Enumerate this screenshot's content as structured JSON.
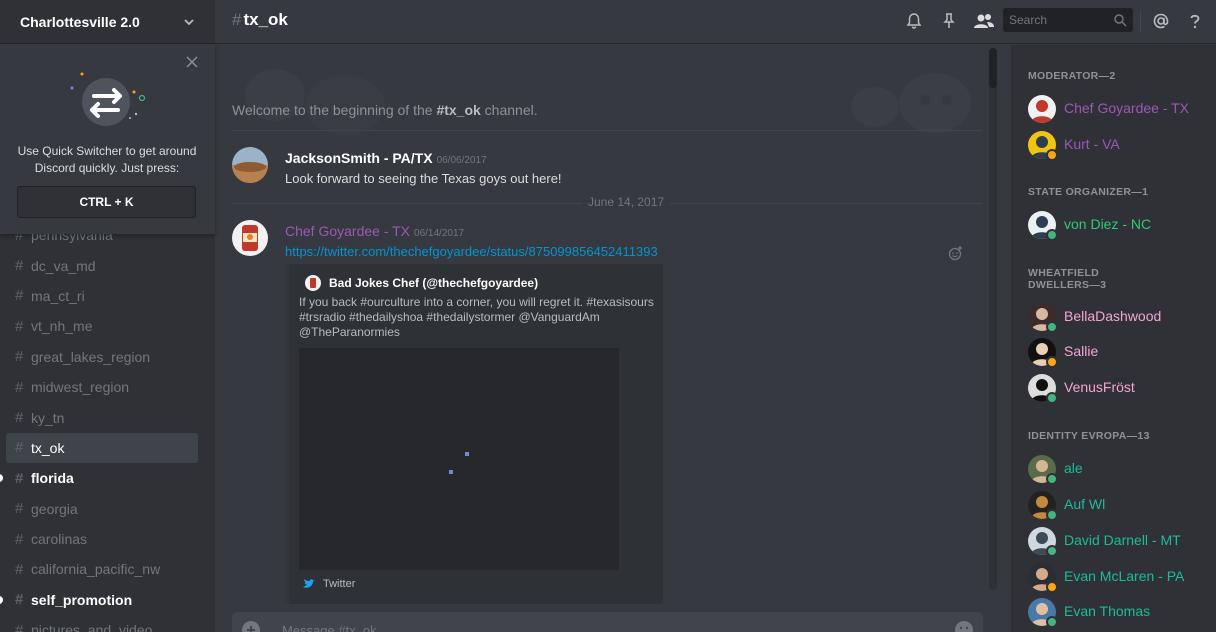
{
  "server": {
    "name": "Charlottesville 2.0"
  },
  "quick_switcher": {
    "text": "Use Quick Switcher to get around Discord quickly. Just press:",
    "shortcut": "CTRL + K"
  },
  "channels": [
    {
      "name": "pennsylvania",
      "state": "normal"
    },
    {
      "name": "dc_va_md",
      "state": "normal"
    },
    {
      "name": "ma_ct_ri",
      "state": "normal"
    },
    {
      "name": "vt_nh_me",
      "state": "normal"
    },
    {
      "name": "great_lakes_region",
      "state": "normal"
    },
    {
      "name": "midwest_region",
      "state": "normal"
    },
    {
      "name": "ky_tn",
      "state": "normal"
    },
    {
      "name": "tx_ok",
      "state": "active"
    },
    {
      "name": "florida",
      "state": "unread"
    },
    {
      "name": "georgia",
      "state": "normal"
    },
    {
      "name": "carolinas",
      "state": "normal"
    },
    {
      "name": "california_pacific_nw",
      "state": "normal"
    },
    {
      "name": "self_promotion",
      "state": "unread"
    },
    {
      "name": "pictures_and_video",
      "state": "normal"
    }
  ],
  "header": {
    "channel": "tx_ok",
    "hash": "#",
    "search_placeholder": "Search",
    "icons": [
      "bell-icon",
      "pin-icon",
      "members-icon",
      "search-icon",
      "mention-icon",
      "help-icon"
    ]
  },
  "chat": {
    "welcome_prefix": "Welcome to the beginning of the ",
    "welcome_channel": "#tx_ok",
    "welcome_suffix": " channel.",
    "date_divider": "June 14, 2017",
    "messages": [
      {
        "author": "JacksonSmith - PA/TX",
        "timestamp": "06/06/2017",
        "text": "Look forward to seeing the Texas goys out here!"
      },
      {
        "author": "Chef Goyardee - TX",
        "timestamp": "06/14/2017",
        "link": "https://twitter.com/thechefgoyardee/status/875099856452411393",
        "embed": {
          "author": "Bad Jokes Chef (@thechefgoyardee)",
          "description": "If you back #ourculture into a corner, you will regret it. #texasisours #trsradio #thedailyshoa #thedailystormer @VanguardAm @TheParanormies",
          "footer": "Twitter"
        }
      }
    ],
    "composer_placeholder": "Message #tx_ok"
  },
  "members": {
    "groups": [
      {
        "title": "MODERATOR—2",
        "members": [
          {
            "name": "Chef Goyardee - TX",
            "color": "#9b59b6",
            "status": "none"
          },
          {
            "name": "Kurt - VA",
            "color": "#9b59b6",
            "status": "idle"
          }
        ]
      },
      {
        "title": "STATE ORGANIZER—1",
        "members": [
          {
            "name": "von Diez - NC",
            "color": "#2ecc71",
            "status": "online"
          }
        ]
      },
      {
        "title": "WHEATFIELD DWELLERS—3",
        "members": [
          {
            "name": "BellaDashwood",
            "color": "#f5a3d7",
            "status": "online"
          },
          {
            "name": "Sallie",
            "color": "#f5a3d7",
            "status": "idle"
          },
          {
            "name": "VenusFröst",
            "color": "#f5a3d7",
            "status": "online"
          }
        ]
      },
      {
        "title": "IDENTITY EVROPA—13",
        "members": [
          {
            "name": "ale",
            "color": "#1abc9c",
            "status": "online"
          },
          {
            "name": "Auf Wl",
            "color": "#1abc9c",
            "status": "online"
          },
          {
            "name": "David Darnell - MT",
            "color": "#1abc9c",
            "status": "online"
          },
          {
            "name": "Evan McLaren - PA",
            "color": "#1abc9c",
            "status": "idle"
          },
          {
            "name": "Evan Thomas",
            "color": "#1abc9c",
            "status": "online"
          }
        ]
      }
    ]
  },
  "colors": {
    "online": "#43b581",
    "idle": "#faa61a",
    "link": "#0096cf"
  }
}
